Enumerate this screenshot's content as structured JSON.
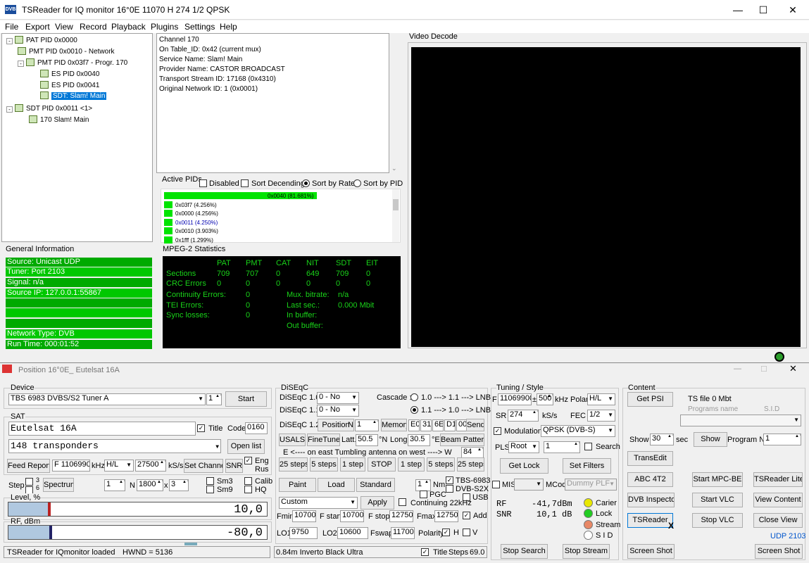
{
  "window": {
    "title": "TSReader  for  IQ monitor   16°0E    11070  H  274  1/2  QPSK",
    "icon": "DVB",
    "min": "—",
    "max": "☐",
    "close": "✕"
  },
  "menu": [
    "File",
    "Export",
    "View",
    "Record",
    "Playback",
    "Plugins",
    "Settings",
    "Help"
  ],
  "tree": [
    "PAT PID 0x0000",
    "PMT PID 0x0010 - Network",
    "PMT PID 0x03f7 - Progr. 170",
    "ES PID 0x0040",
    "ES PID 0x0041",
    "SDT: Slam!    Main",
    "SDT PID 0x0011 <1>",
    "170 Slam!     Main"
  ],
  "info": [
    "Channel 170",
    "On Table_ID: 0x42 (current mux)",
    "Service Name: Slam!    Main",
    "Provider Name: CASTOR BROADCAST",
    "Transport Stream ID: 17168 (0x4310)",
    "Original Network ID: 1 (0x0001)"
  ],
  "active_pids": {
    "label": "Active PIDs",
    "disabled": "Disabled",
    "sort_desc": "Sort Decending",
    "sort_rate": "Sort by Rate",
    "sort_pid": "Sort by PID",
    "items": [
      {
        "pid": "0x0040 (81.681%)",
        "pct": 81.681
      },
      {
        "pid": "0x03f7 (4.256%)",
        "pct": 4.256
      },
      {
        "pid": "0x0000 (4.256%)",
        "pct": 4.256
      },
      {
        "pid": "0x0011 (4.250%)",
        "pct": 4.25
      },
      {
        "pid": "0x0010 (3.903%)",
        "pct": 3.903
      },
      {
        "pid": "0x1fff (1.299%)",
        "pct": 1.299
      }
    ]
  },
  "video": {
    "label": "Video Decode"
  },
  "general": {
    "label": "General Information",
    "lines": [
      "Source: Unicast UDP",
      "Tuner: Port 2103",
      "Signal: n/a",
      "Source IP: 127.0.0.1:55867",
      "",
      "",
      "",
      "Network Type: DVB",
      "Run Time: 000:01:52"
    ]
  },
  "mpeg": {
    "label": "MPEG-2 Statistics",
    "headers": [
      "PAT",
      "PMT",
      "CAT",
      "NIT",
      "SDT",
      "EIT"
    ],
    "sections_label": "Sections",
    "sections": [
      "709",
      "707",
      "0",
      "649",
      "709",
      "0"
    ],
    "crc_label": "CRC Errors",
    "crc": [
      "0",
      "0",
      "0",
      "0",
      "0",
      "0"
    ],
    "cont_label": "Continuity Errors:",
    "cont": "0",
    "tei_label": "TEI Errors:",
    "tei": "0",
    "sync_label": "Sync losses:",
    "sync": "0",
    "mux_label": "Mux. bitrate:",
    "mux": "n/a",
    "last_label": "Last sec.:",
    "last": "0.000 Mbit",
    "inbuf_label": "In buffer:",
    "outbuf_label": "Out buffer:"
  },
  "iq": {
    "title": "Position 16°0E_  Eutelsat 16A",
    "device_label": "Device",
    "device": "TBS 6983 DVBS/S2 Tuner A",
    "device_num": "1",
    "start": "Start",
    "sat_label": "SAT",
    "sat_name": "Eutelsat 16A",
    "title_chk": "Title",
    "code_label": "Code",
    "code": "0160",
    "transponders": "148  transponders",
    "open_list": "Open list",
    "feed_report": "Feed Report",
    "freq": "F 11069900",
    "khz": "kHz",
    "pol": "H/L",
    "sr": "27500",
    "ksps": "kS/s",
    "set_channel": "Set Channel",
    "snr": "SNR",
    "eng": "Eng",
    "rus": "Rus",
    "step_label": "Step",
    "step36": "3\n6",
    "spectrum": "Spectrum",
    "s1": "1",
    "n_label": "N",
    "n_val": "1800",
    "x_label": "x",
    "x_val": "3",
    "sm3": "Sm3",
    "sm9": "Sm9",
    "calib": "Calib",
    "hq": "HQ",
    "level_label": "Level, %",
    "level_val": "10,0",
    "level_pct": 10,
    "rf_label": "RF, dBm",
    "rf_val": "-80,0",
    "status": "TSReader  for  IQmonitor  loaded",
    "hwnd": "HWND = 5136",
    "diseqc_label": "DiSEqC",
    "d10": "DiSEqC 1.0",
    "d10v": "0 - No",
    "d11": "DiSEqC 1.1",
    "d11v": "0 - No",
    "d12": "DiSEqC 1.2",
    "cascade": "Cascade :",
    "c1": "1.0 ---> 1.1 ---> LNB",
    "c2": "1.1 ---> 1.0 ---> LNB",
    "position": "Position",
    "n2": "N",
    "n2v": "1",
    "memory": "Memory",
    "hex": [
      "E0",
      "31",
      "6E",
      "D1",
      "00"
    ],
    "send": "Send",
    "usals": "USALS",
    "finetune": "FineTune",
    "latt": "Latt.",
    "latt_v": "50.5",
    "n_dir": "°N",
    "long": "Long.",
    "long_v": "30.5",
    "e_dir": "°E",
    "beam": "Beam Pattern",
    "tumbling": "E  <----  on  east     Tumbling antenna     on  west  ----> W",
    "w_val": "84",
    "steps": [
      "25 steps",
      "5 steps",
      "1 step",
      "STOP",
      "1 step",
      "5 steps",
      "25 steps"
    ],
    "paint": "Paint",
    "load": "Load",
    "standard": "Standard",
    "nm_v": "1",
    "nm": "Nm",
    "pgc": "PGC",
    "tbs": "TBS-6983",
    "dvbs2x": "DVB-S2X",
    "usb": "USB",
    "custom": "Custom",
    "apply": "Apply",
    "cont22": "Continuing 22kHz",
    "fmin": "Fmin",
    "fmin_v": "10700",
    "fstart": "F start",
    "fstart_v": "10700",
    "fstop": "F stop",
    "fstop_v": "12750",
    "fmax": "Fmax",
    "fmax_v": "12750",
    "add": "Add",
    "lo1": "LO1",
    "lo1_v": "9750",
    "lo2": "LO2",
    "lo2_v": "10600",
    "fswap": "Fswap",
    "fswap_v": "11700",
    "polarity": "Polarity",
    "h": "H",
    "v": "V",
    "lnb_info": "0.84m  Inverto Black Ultra",
    "title2": "Title",
    "steps_lbl": "Steps",
    "steps_v": "69.0",
    "tuning_label": "Tuning / Style",
    "tf": "F",
    "tf_v": "11069900",
    "pm": "±",
    "pm_v": "500",
    "tkhz": "kHz",
    "polar": "Polar",
    "polar_v": "H/L",
    "tsr": "SR",
    "tsr_v": "274",
    "tksps": "kS/s",
    "fec": "FEC",
    "fec_v": "1/2",
    "modulation": "Modulation",
    "mod_v": "QPSK (DVB-S)",
    "pls": "PLS",
    "pls_v": "Root",
    "pls_n": "1",
    "search": "Search",
    "get_lock": "Get Lock",
    "set_filters": "Set Filters",
    "mis": "MIS",
    "mcod": "MCod",
    "mcod_v": "Dummy PLF",
    "rf": "RF",
    "rf_v": "-41,7dBm",
    "snr2": "SNR",
    "snr_v": "10,1 dB",
    "carier": "Carier",
    "lock": "Lock",
    "stream": "Stream",
    "sid": "S I D",
    "stop_search": "Stop Search",
    "stop_stream": "Stop Stream",
    "content_label": "Content",
    "get_psi": "Get PSI",
    "tsfile": "TS file  0 Mbt",
    "prog_name": "Programs  name",
    "sid_col": "S.I.D",
    "show": "Show",
    "show_v": "30",
    "sec": "sec",
    "show_btn": "Show",
    "program": "Program  №",
    "prog_v": "1",
    "transedit": "TransEdit",
    "abc": "ABC 4T2",
    "mpcbe": "Start  MPC-BE",
    "tslite": "TSReader Lite",
    "dvbinsp": "DVB Inspector",
    "vlc": "Start  VLC",
    "viewcontent": "View Content",
    "tsreader": "TSReader",
    "stopvlc": "Stop  VLC",
    "closeview": "Close View",
    "udp": "UDP 2103",
    "screenshot1": "Screen Shot",
    "screenshot2": "Screen Shot"
  }
}
